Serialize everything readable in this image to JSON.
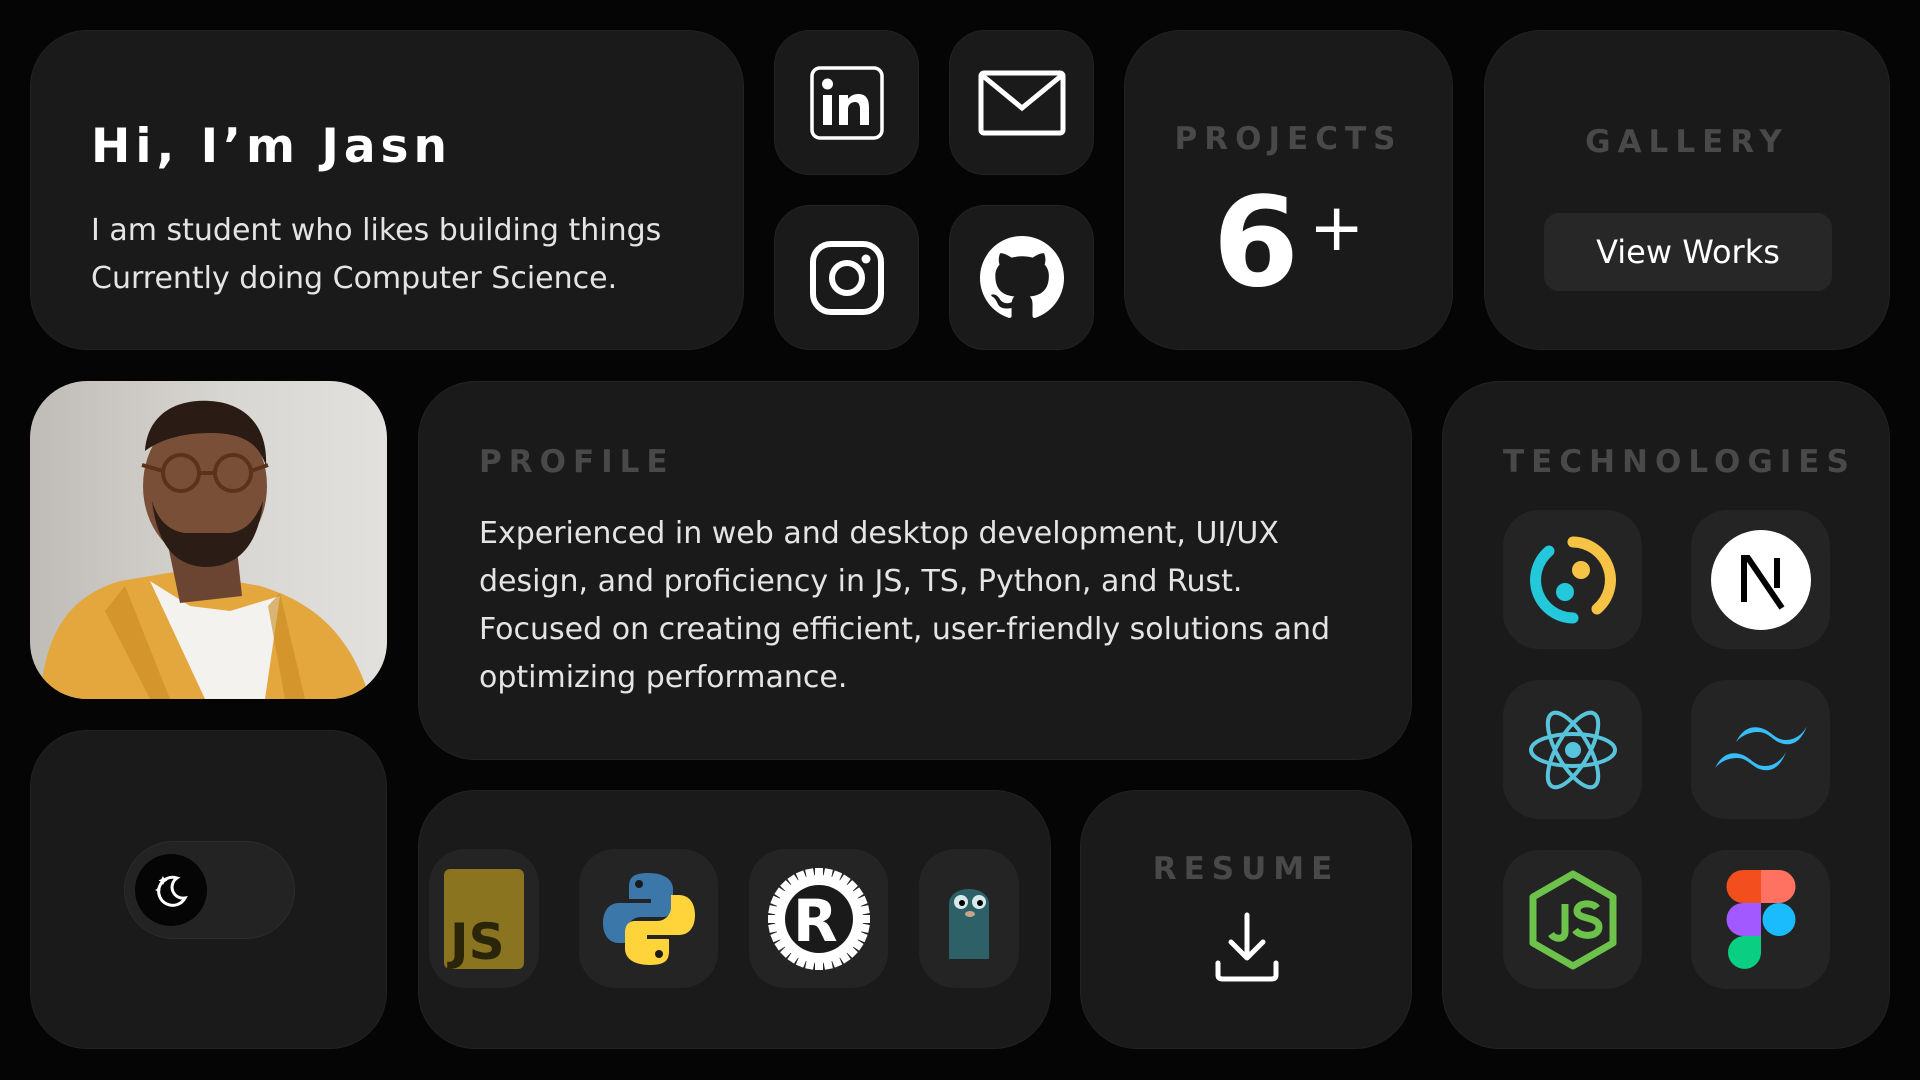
{
  "intro": {
    "greeting": "Hi, I’m Jasn",
    "line1": "I am student who likes building things",
    "line2": "Currently doing Computer Science."
  },
  "socials": [
    "linkedin-icon",
    "mail-icon",
    "instagram-icon",
    "github-icon"
  ],
  "projects": {
    "label": "PROJECTS",
    "count": "6",
    "suffix": "+"
  },
  "gallery": {
    "label": "GALLERY",
    "button": "View Works"
  },
  "profile": {
    "label": "PROFILE",
    "text": "Experienced in web and desktop development, UI/UX design, and proficiency in JS, TS, Python, and Rust. Focused on creating efficient, user-friendly solutions and optimizing performance."
  },
  "technologies": {
    "label": "TECHNOLOGIES",
    "icons": [
      "tauri-icon",
      "nextjs-icon",
      "react-icon",
      "tailwind-icon",
      "nodejs-icon",
      "figma-icon"
    ]
  },
  "theme_toggle": {
    "icon": "moon-stars-icon",
    "state": "dark"
  },
  "languages": {
    "icons": [
      "javascript-icon",
      "python-icon",
      "rust-icon",
      "go-gopher-icon"
    ]
  },
  "resume": {
    "label": "RESUME",
    "icon": "download-icon"
  },
  "colors": {
    "background": "#050505",
    "card": "#1a1a1a",
    "label": "#494949",
    "tile": "#242424"
  }
}
